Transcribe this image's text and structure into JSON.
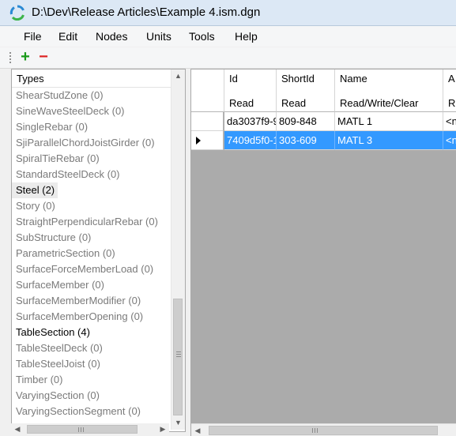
{
  "window": {
    "title": "D:\\Dev\\Release Articles\\Example 4.ism.dgn",
    "app_icon": "refresh-cycle-icon"
  },
  "menu": {
    "items": [
      "File",
      "Edit",
      "Nodes",
      "Units",
      "Tools",
      "Help"
    ]
  },
  "toolbar": {
    "add_label": "+",
    "remove_label": "−",
    "add_icon": "plus-icon",
    "remove_icon": "minus-icon",
    "add_color": "#1a9a1a",
    "remove_color": "#dd2222"
  },
  "types_panel": {
    "header": "Types",
    "items": [
      {
        "label": "ShearStudZone (0)"
      },
      {
        "label": "SineWaveSteelDeck (0)"
      },
      {
        "label": "SingleRebar (0)"
      },
      {
        "label": "SjiParallelChordJoistGirder (0)"
      },
      {
        "label": "SpiralTieRebar (0)"
      },
      {
        "label": "StandardSteelDeck (0)"
      },
      {
        "label": "Steel (2)"
      },
      {
        "label": "Story (0)"
      },
      {
        "label": "StraightPerpendicularRebar (0)"
      },
      {
        "label": "SubStructure (0)"
      },
      {
        "label": "ParametricSection (0)"
      },
      {
        "label": "SurfaceForceMemberLoad (0)"
      },
      {
        "label": "SurfaceMember (0)"
      },
      {
        "label": "SurfaceMemberModifier (0)"
      },
      {
        "label": "SurfaceMemberOpening (0)"
      },
      {
        "label": "TableSection (4)"
      },
      {
        "label": "TableSteelDeck (0)"
      },
      {
        "label": "TableSteelJoist (0)"
      },
      {
        "label": "Timber (0)"
      },
      {
        "label": "VaryingSection (0)"
      },
      {
        "label": "VaryingSectionSegment (0)"
      }
    ]
  },
  "grid": {
    "columns": [
      {
        "name": "Id",
        "access": "Read"
      },
      {
        "name": "ShortId",
        "access": "Read"
      },
      {
        "name": "Name",
        "access": "Read/Write/Clear"
      },
      {
        "name": "A",
        "access": "R"
      }
    ],
    "rows": [
      {
        "id": "da3037f9-9",
        "shortid": "809-848",
        "name": "MATL 1",
        "extra": "<n"
      },
      {
        "id": "7409d5f0-1",
        "shortid": "303-609",
        "name": "MATL 3",
        "extra": "<n"
      }
    ],
    "selection_color": "#3399ff"
  }
}
